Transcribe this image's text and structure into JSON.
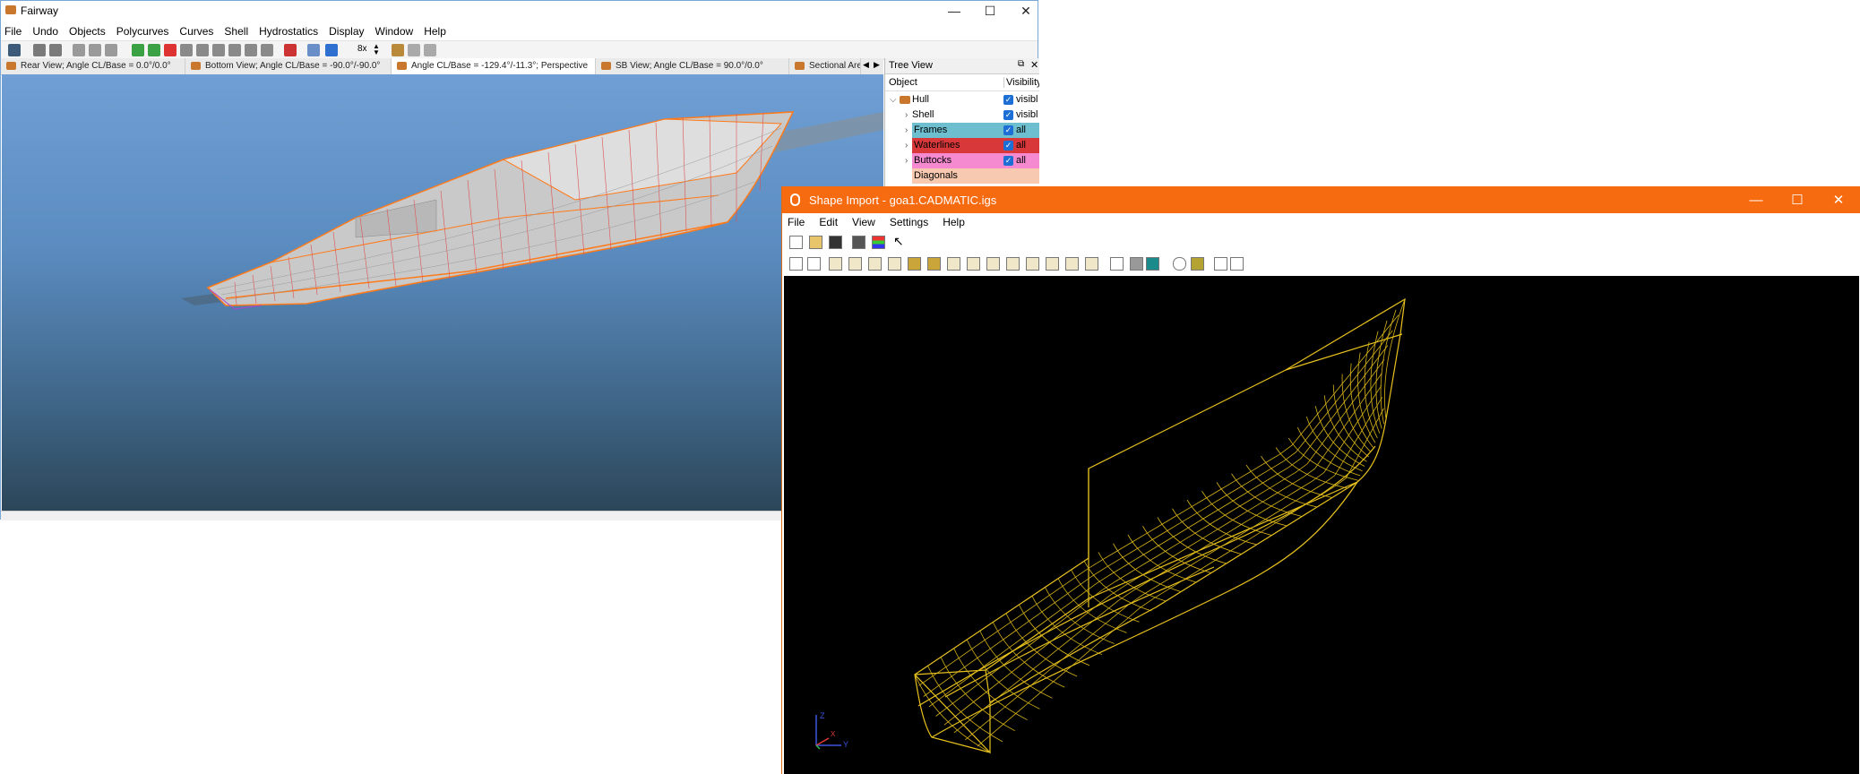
{
  "fairway": {
    "title": "Fairway",
    "window_controls": {
      "minimize": "—",
      "maximize": "☐",
      "close": "✕"
    },
    "menu": [
      "File",
      "Undo",
      "Objects",
      "Polycurves",
      "Curves",
      "Shell",
      "Hydrostatics",
      "Display",
      "Window",
      "Help"
    ],
    "toolbar": {
      "zoom_value": "8x"
    },
    "tabs": [
      "Rear View; Angle CL/Base = 0.0°/0.0°",
      "Bottom View; Angle CL/Base = -90.0°/-90.0°",
      "Angle CL/Base = -129.4°/-11.3°; Perspective",
      "SB View; Angle CL/Base = 90.0°/0.0°",
      "Sectional Area"
    ],
    "active_tab": 2,
    "tree": {
      "title": "Tree View",
      "col_object": "Object",
      "col_visibility": "Visibility",
      "rows": [
        {
          "label": "Hull",
          "value": "visibl",
          "bg": ""
        },
        {
          "label": "Shell",
          "value": "visibl",
          "bg": ""
        },
        {
          "label": "Frames",
          "value": "all",
          "bg": "#6dbfcf"
        },
        {
          "label": "Waterlines",
          "value": "all",
          "bg": "#d9383a"
        },
        {
          "label": "Buttocks",
          "value": "all",
          "bg": "#f58ad0"
        },
        {
          "label": "Diagonals",
          "value": "",
          "bg": "#f7c9b0"
        }
      ]
    }
  },
  "shape_import": {
    "title": "Shape Import - goa1.CADMATIC.igs",
    "window_controls": {
      "minimize": "—",
      "maximize": "☐",
      "close": "✕"
    },
    "menu": [
      "File",
      "Edit",
      "View",
      "Settings",
      "Help"
    ],
    "axes": {
      "z": "Z",
      "y": "Y",
      "x": "X"
    }
  },
  "colors": {
    "fairway_sky_top": "#6f9fd4",
    "fairway_sky_bottom": "#2c4659",
    "shape_import_accent": "#f66b10",
    "wireframe": "#e8c21f",
    "hull_edge": "#ff7a1a"
  }
}
